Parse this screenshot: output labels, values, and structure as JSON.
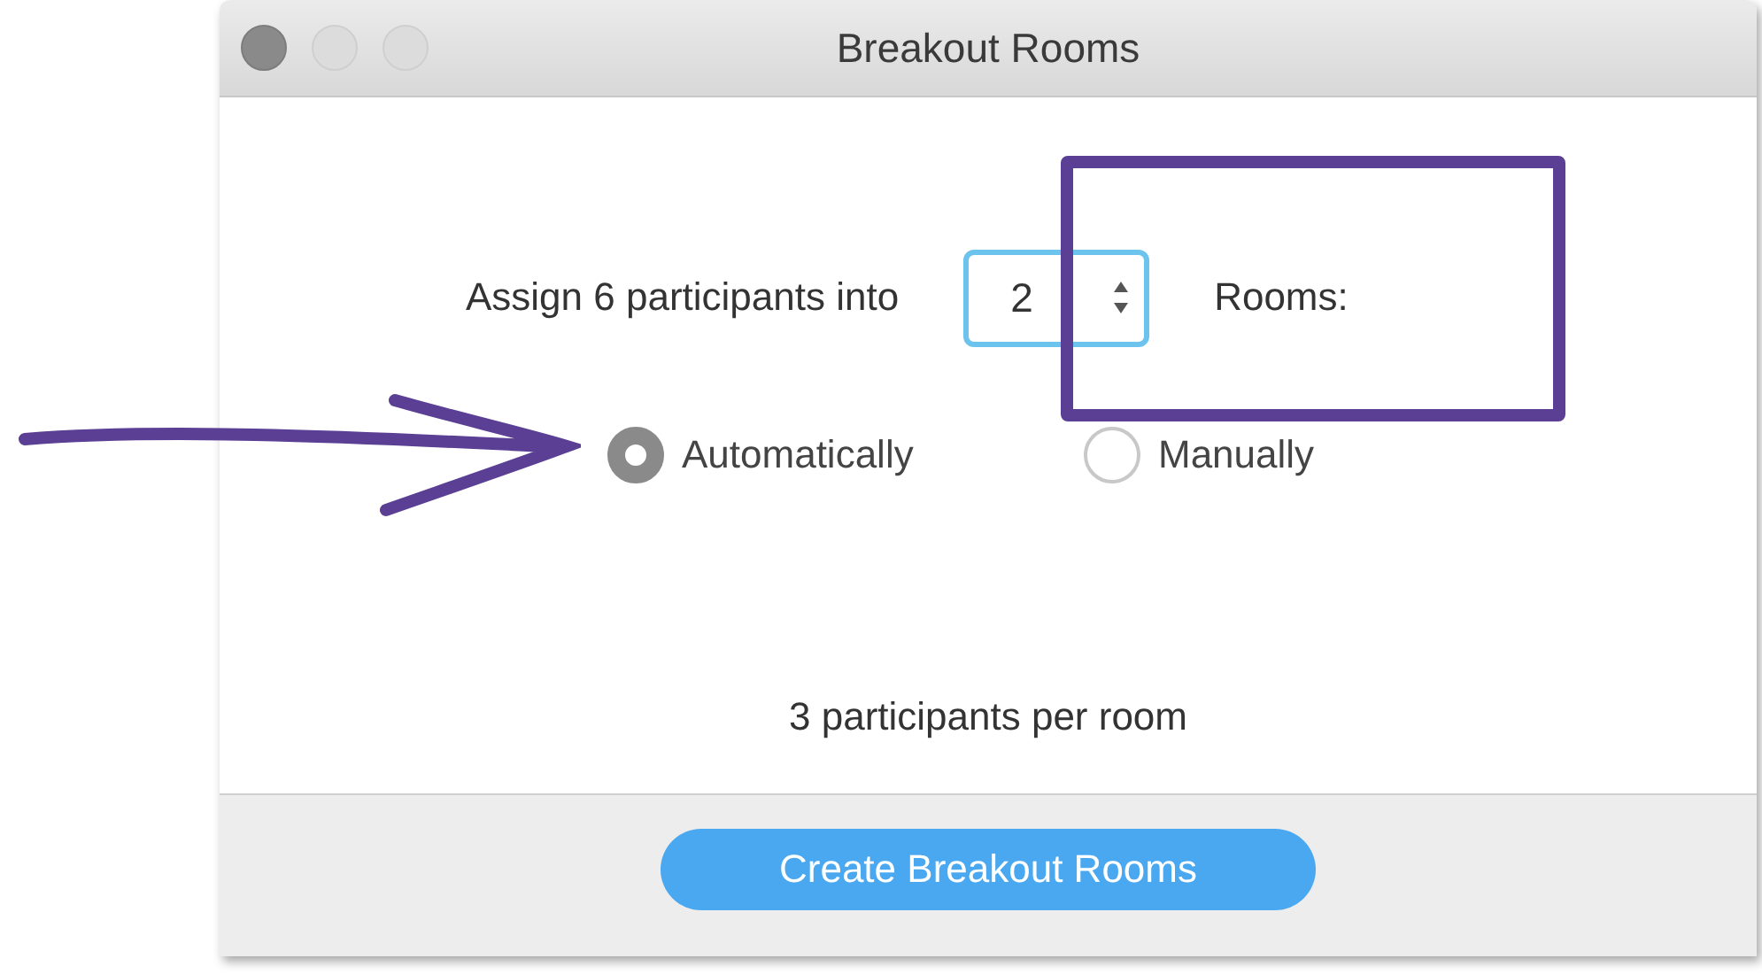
{
  "window": {
    "title": "Breakout Rooms"
  },
  "assign": {
    "prefix": "Assign 6 participants into",
    "rooms": "2",
    "suffix": "Rooms:"
  },
  "options": [
    {
      "label": "Automatically",
      "selected": true
    },
    {
      "label": "Manually",
      "selected": false
    }
  ],
  "summary": "3 participants per room",
  "button": {
    "label": "Create Breakout Rooms"
  },
  "annotations": [
    {
      "kind": "arrow"
    },
    {
      "kind": "box"
    }
  ]
}
